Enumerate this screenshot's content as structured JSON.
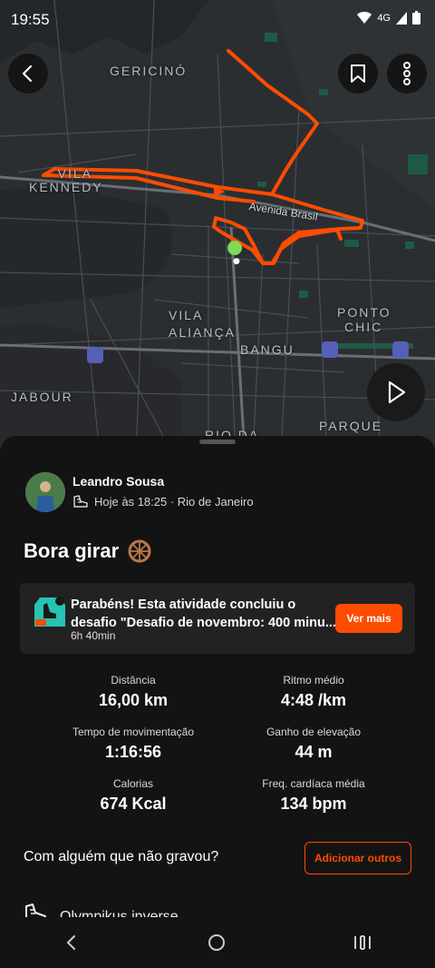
{
  "status_bar": {
    "time": "19:55",
    "network": "4G"
  },
  "map": {
    "labels": {
      "gericino": "GERICINÓ",
      "vila_kennedy_1": "VILA",
      "vila_kennedy_2": "KENNEDY",
      "avenida_brasil": "Avenida Brasil",
      "vila_alianca_1": "VILA",
      "vila_alianca_2": "ALIANÇA",
      "ponto_chic_1": "PONTO",
      "ponto_chic_2": "CHIC",
      "bangu": "BANGU",
      "jabour": "JABOUR",
      "parque": "PARQUE",
      "rio_da": "RIO DA"
    },
    "route_color": "#fc4c02"
  },
  "activity": {
    "athlete": "Leandro Sousa",
    "meta": "Hoje às 18:25 · Rio de Janeiro",
    "title": "Bora girar",
    "challenge": {
      "line1": "Parabéns! Esta atividade concluiu o",
      "line2": "desafio \"Desafio de novembro: 400 minu...",
      "duration": "6h 40min",
      "button": "Ver mais"
    },
    "stats": [
      {
        "label": "Distância",
        "value": "16,00 km"
      },
      {
        "label": "Ritmo médio",
        "value": "4:48 /km"
      },
      {
        "label": "Tempo de movimentação",
        "value": "1:16:56"
      },
      {
        "label": "Ganho de elevação",
        "value": "44 m"
      },
      {
        "label": "Calorias",
        "value": "674 Kcal"
      },
      {
        "label": "Freq. cardíaca média",
        "value": "134 bpm"
      }
    ],
    "others_prompt": "Com alguém que não gravou?",
    "add_others_button": "Adicionar outros",
    "gear": "Olympikus inverse"
  },
  "icons": {
    "back": "back-arrow-icon",
    "bookmark": "bookmark-icon",
    "more": "more-vertical-icon",
    "play": "play-icon",
    "shoe": "shoe-icon",
    "wheel": "wheel-emoji-icon"
  },
  "colors": {
    "accent": "#fc4c02",
    "sheet_bg": "#131313",
    "card_bg": "#222222",
    "start_marker": "#7ed957"
  }
}
